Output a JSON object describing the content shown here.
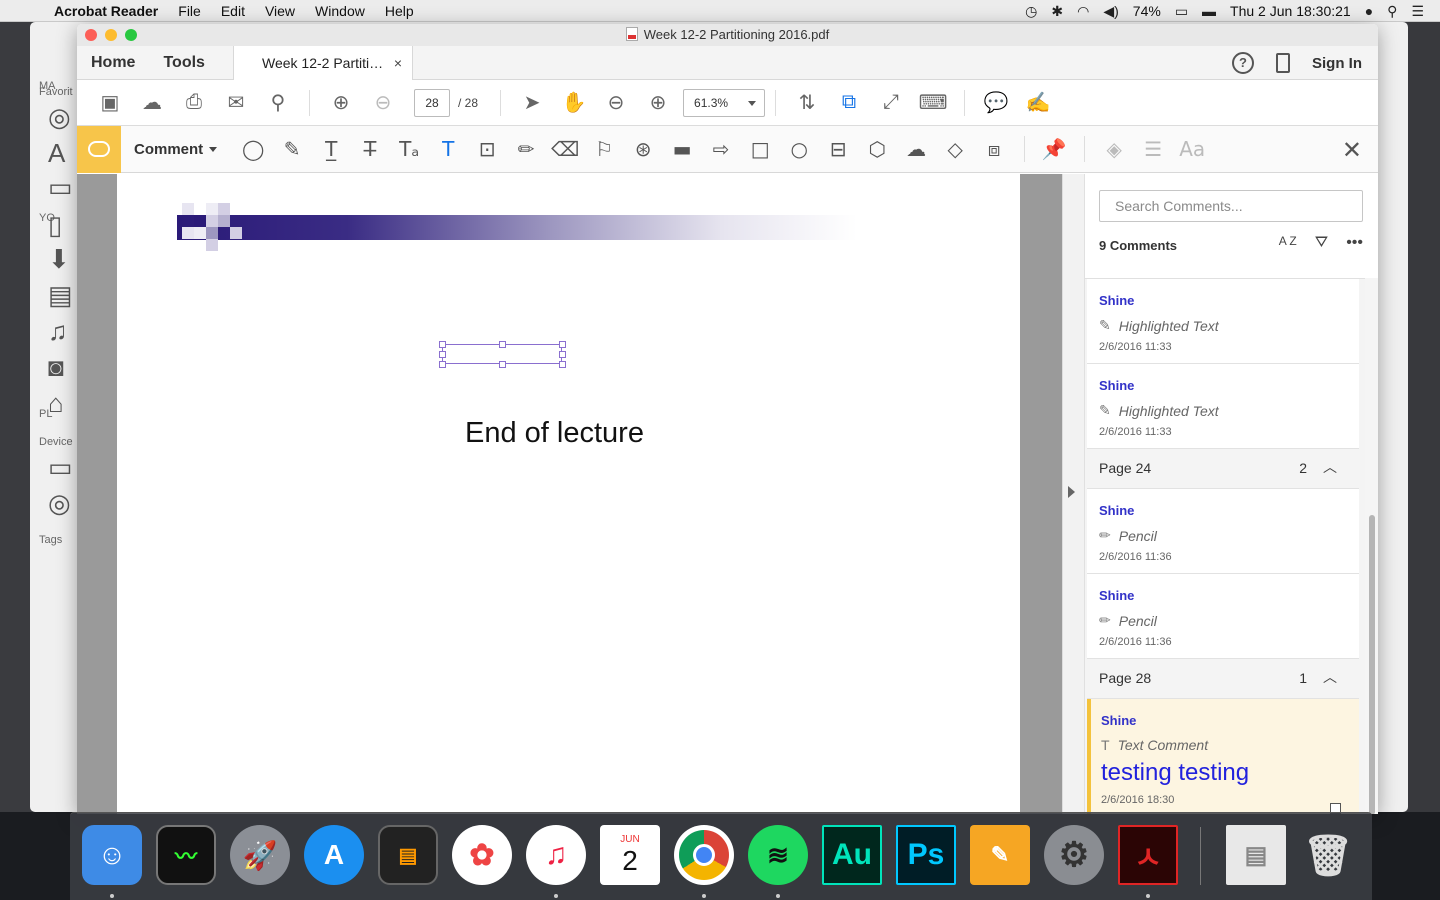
{
  "menubar": {
    "app_name": "Acrobat Reader",
    "menus": [
      "File",
      "Edit",
      "View",
      "Window",
      "Help"
    ],
    "battery": "74%",
    "datetime": "Thu 2 Jun  18:30:21"
  },
  "itunes": {
    "favorites_label": "Favorit",
    "devices_label": "Device",
    "tags_label": "Tags",
    "section_m": "MA",
    "section_y": "YO",
    "section_p": "PL"
  },
  "window": {
    "title": "Week 12-2 Partitioning 2016.pdf"
  },
  "tabs": {
    "home": "Home",
    "tools": "Tools",
    "doc": "Week 12-2 Partiti…",
    "close": "×",
    "help": "?",
    "sign_in": "Sign In"
  },
  "toolbar": {
    "page_current": "28",
    "page_total": "/  28",
    "zoom": "61.3%"
  },
  "commentbar": {
    "label": "Comment",
    "close": "✕",
    "font_tool": "Aa"
  },
  "document": {
    "text": "End of lecture"
  },
  "pane": {
    "search_placeholder": "Search Comments...",
    "count_label": "9 Comments",
    "sort_label": "A Z",
    "comments_top": [
      {
        "author": "Shine",
        "type": "Highlighted Text",
        "date": "2/6/2016  11:33"
      },
      {
        "author": "Shine",
        "type": "Highlighted Text",
        "date": "2/6/2016  11:33"
      }
    ],
    "page24": {
      "label": "Page 24",
      "count": "2"
    },
    "comments_p24": [
      {
        "author": "Shine",
        "type": "Pencil",
        "date": "2/6/2016  11:36"
      },
      {
        "author": "Shine",
        "type": "Pencil",
        "date": "2/6/2016  11:36"
      }
    ],
    "page28": {
      "label": "Page 28",
      "count": "1"
    },
    "active_comment": {
      "author": "Shine",
      "type": "Text Comment",
      "text": "testing testing",
      "date": "2/6/2016  18:30"
    }
  },
  "dock": {
    "calendar_month": "JUN",
    "calendar_day": "2",
    "audition": "Au",
    "photoshop": "Ps"
  },
  "colors": {
    "comment_accent": "#f7c54a",
    "author_blue": "#3232c8",
    "active_bg": "#fdf5e1",
    "banner_dark": "#2a1a78"
  }
}
